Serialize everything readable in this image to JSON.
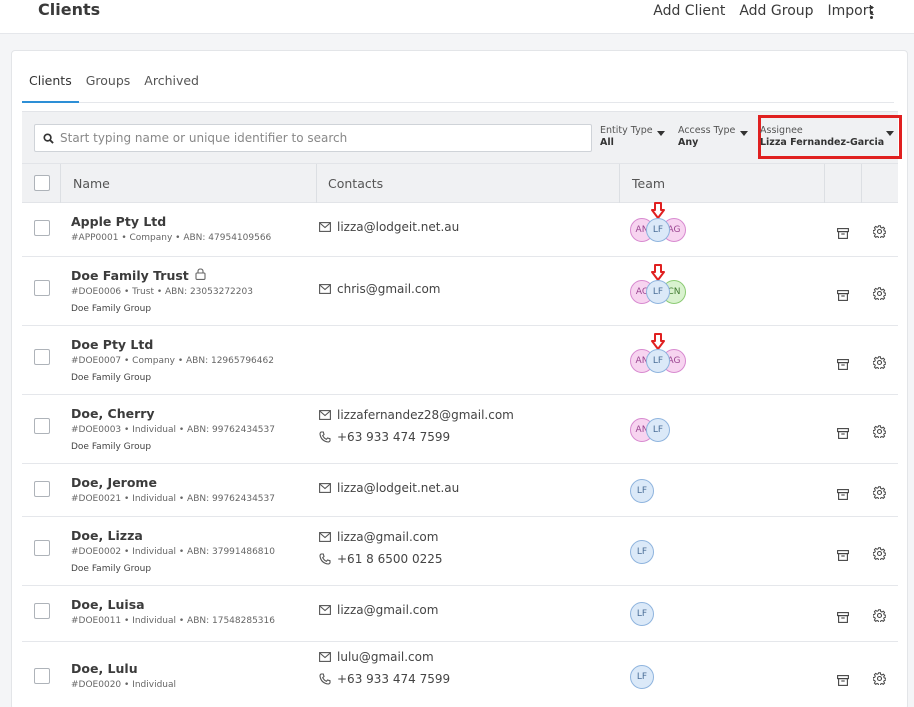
{
  "header": {
    "title": "Clients",
    "actions": [
      "Add Client",
      "Add Group",
      "Import"
    ]
  },
  "tabs": [
    {
      "label": "Clients",
      "active": true
    },
    {
      "label": "Groups",
      "active": false
    },
    {
      "label": "Archived",
      "active": false
    }
  ],
  "search": {
    "placeholder": "Start typing name or unique identifier to search"
  },
  "filters": {
    "entity_type": {
      "label": "Entity Type",
      "value": "All"
    },
    "access_type": {
      "label": "Access Type",
      "value": "Any"
    },
    "assignee": {
      "label": "Assignee",
      "value": "Lizza Fernandez-Garcia"
    }
  },
  "columns": [
    "Name",
    "Contacts",
    "Team"
  ],
  "rows": [
    {
      "name": "Apple Pty Ltd",
      "meta": "#APP0001 • Company • ABN: 47954109566",
      "group": "",
      "locked": false,
      "contacts": [
        {
          "type": "email",
          "value": "lizza@lodgeit.net.au"
        }
      ],
      "team": [
        {
          "initials": "AN",
          "color": "pink"
        },
        {
          "initials": "LF",
          "color": "blue"
        },
        {
          "initials": "AG",
          "color": "pink"
        }
      ],
      "marker": true
    },
    {
      "name": "Doe Family Trust",
      "meta": "#DOE0006 • Trust • ABN: 23053272203",
      "group": "Doe Family Group",
      "locked": true,
      "contacts": [
        {
          "type": "email",
          "value": "chris@gmail.com"
        }
      ],
      "team": [
        {
          "initials": "AC",
          "color": "pink"
        },
        {
          "initials": "LF",
          "color": "blue"
        },
        {
          "initials": "CN",
          "color": "green"
        }
      ],
      "marker": true
    },
    {
      "name": "Doe Pty Ltd",
      "meta": "#DOE0007 • Company • ABN: 12965796462",
      "group": "Doe Family Group",
      "locked": false,
      "contacts": [],
      "team": [
        {
          "initials": "AN",
          "color": "pink"
        },
        {
          "initials": "LF",
          "color": "blue"
        },
        {
          "initials": "AG",
          "color": "pink"
        }
      ],
      "marker": true
    },
    {
      "name": "Doe, Cherry",
      "meta": "#DOE0003 • Individual • ABN: 99762434537",
      "group": "Doe Family Group",
      "locked": false,
      "contacts": [
        {
          "type": "email",
          "value": "lizzafernandez28@gmail.com"
        },
        {
          "type": "phone",
          "value": "+63 933 474 7599"
        }
      ],
      "team": [
        {
          "initials": "AN",
          "color": "pink"
        },
        {
          "initials": "LF",
          "color": "blue"
        }
      ],
      "marker": false
    },
    {
      "name": "Doe, Jerome",
      "meta": "#DOE0021 • Individual • ABN: 99762434537",
      "group": "",
      "locked": false,
      "contacts": [
        {
          "type": "email",
          "value": "lizza@lodgeit.net.au"
        }
      ],
      "team": [
        {
          "initials": "LF",
          "color": "blue"
        }
      ],
      "marker": false
    },
    {
      "name": "Doe, Lizza",
      "meta": "#DOE0002 • Individual • ABN: 37991486810",
      "group": "Doe Family Group",
      "locked": false,
      "contacts": [
        {
          "type": "email",
          "value": "lizza@gmail.com"
        },
        {
          "type": "phone",
          "value": "+61 8 6500 0225"
        }
      ],
      "team": [
        {
          "initials": "LF",
          "color": "blue"
        }
      ],
      "marker": false
    },
    {
      "name": "Doe, Luisa",
      "meta": "#DOE0011 • Individual • ABN: 17548285316",
      "group": "",
      "locked": false,
      "contacts": [
        {
          "type": "email",
          "value": "lizza@gmail.com"
        }
      ],
      "team": [
        {
          "initials": "LF",
          "color": "blue"
        }
      ],
      "marker": false
    },
    {
      "name": "Doe, Lulu",
      "meta": "#DOE0020 • Individual",
      "group": "",
      "locked": false,
      "contacts": [
        {
          "type": "email",
          "value": "lulu@gmail.com"
        },
        {
          "type": "phone",
          "value": "+63 933 474 7599"
        }
      ],
      "team": [
        {
          "initials": "LF",
          "color": "blue"
        }
      ],
      "marker": false
    }
  ]
}
